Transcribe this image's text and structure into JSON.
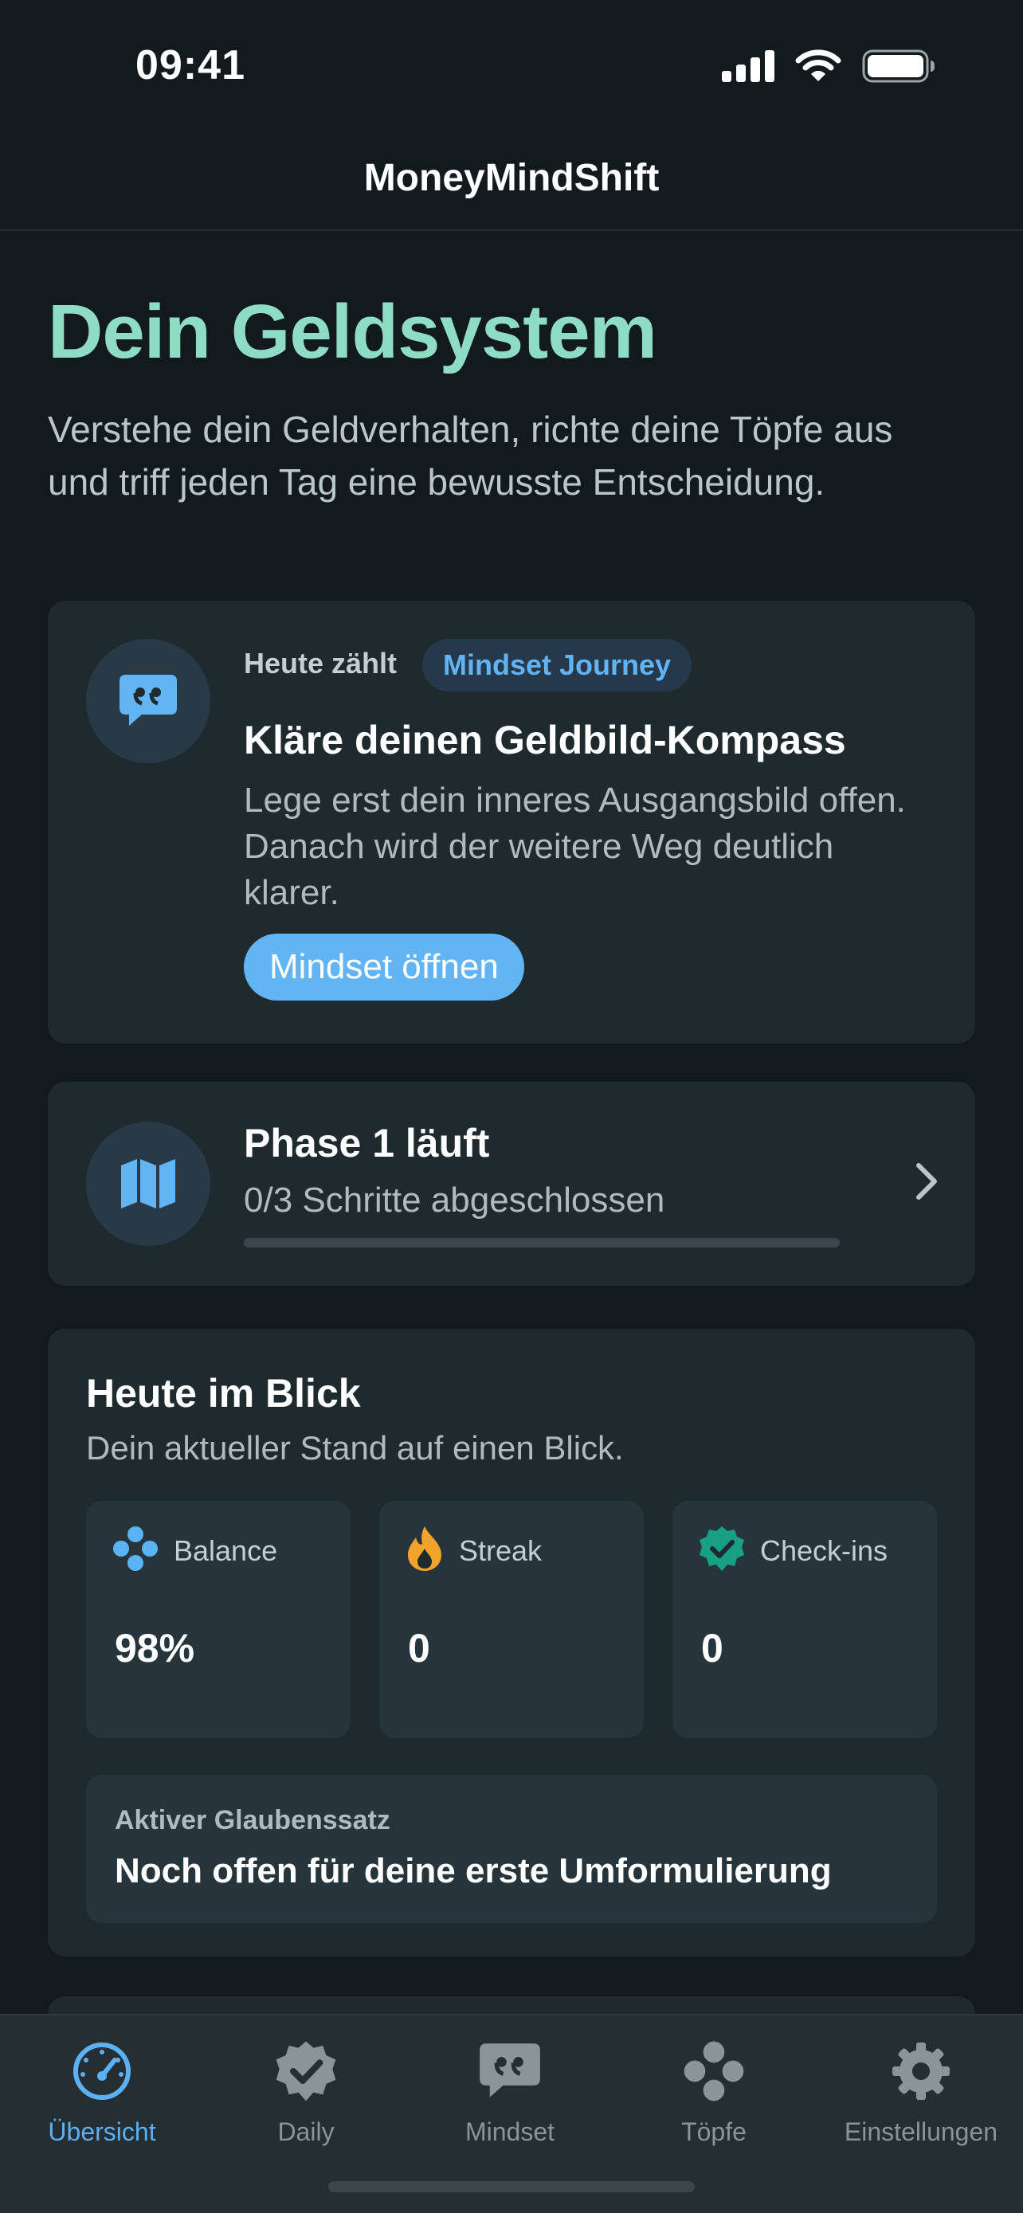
{
  "status_bar": {
    "time": "09:41",
    "icons": [
      "cellular-signal-icon",
      "wifi-icon",
      "battery-icon"
    ]
  },
  "nav": {
    "title": "MoneyMindShift"
  },
  "header": {
    "title": "Dein Geldsystem",
    "subtitle": "Verstehe dein Geldverhalten, richte deine Töpfe aus und triff jeden Tag eine bewusste Entscheidung."
  },
  "focus_card": {
    "icon": "quote-bubble-icon",
    "label": "Heute zählt",
    "pill": "Mindset Journey",
    "title": "Kläre deinen Geldbild-Kompass",
    "text": "Lege erst dein inneres Ausgangsbild offen. Danach wird der weitere Weg deutlich klarer.",
    "button_label": "Mindset öffnen"
  },
  "phase_card": {
    "icon": "map-icon",
    "title": "Phase 1 läuft",
    "subtitle": "0/3 Schritte abgeschlossen",
    "progress": 0
  },
  "today_card": {
    "title": "Heute im Blick",
    "subtitle": "Dein aktueller Stand auf einen Blick.",
    "stats": [
      {
        "icon": "balance-dots-icon",
        "label": "Balance",
        "value": "98%"
      },
      {
        "icon": "flame-icon",
        "label": "Streak",
        "value": "0"
      },
      {
        "icon": "check-seal-icon",
        "label": "Check-ins",
        "value": "0"
      }
    ],
    "belief": {
      "label": "Aktiver Glaubenssatz",
      "text": "Noch offen für deine erste Umformulierung"
    }
  },
  "tab_bar": {
    "active": "Übersicht",
    "tabs": [
      {
        "label": "Übersicht",
        "icon": "gauge-icon"
      },
      {
        "label": "Daily",
        "icon": "check-seal-icon"
      },
      {
        "label": "Mindset",
        "icon": "quote-bubble-icon"
      },
      {
        "label": "Töpfe",
        "icon": "pots-dots-icon"
      },
      {
        "label": "Einstellungen",
        "icon": "gear-icon"
      }
    ]
  },
  "colors": {
    "background": "#121a1e",
    "card": "#1f2a2f",
    "accent_mint": "#8fdcc4",
    "accent_blue": "#63b4f3",
    "flame": "#f2a329",
    "check": "#18a085"
  }
}
